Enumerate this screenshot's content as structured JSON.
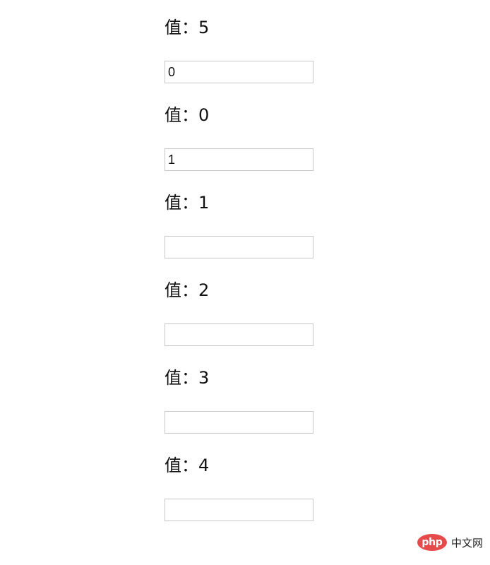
{
  "rows": [
    {
      "label": "值：5",
      "input_value": "0"
    },
    {
      "label": "值：0",
      "input_value": "1"
    },
    {
      "label": "值：1",
      "input_value": ""
    },
    {
      "label": "值：2",
      "input_value": ""
    },
    {
      "label": "值：3",
      "input_value": ""
    },
    {
      "label": "值：4",
      "input_value": ""
    }
  ],
  "watermark": {
    "logo": "php",
    "site": "中文网"
  }
}
